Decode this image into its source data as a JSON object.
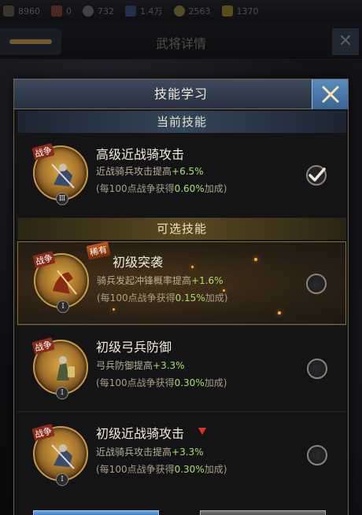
{
  "top_resources": [
    {
      "name": "power",
      "value": "8960"
    },
    {
      "name": "honor",
      "value": "0"
    },
    {
      "name": "food",
      "value": "732"
    },
    {
      "name": "coins",
      "value": "1.4万"
    },
    {
      "name": "gold",
      "value": "2563"
    },
    {
      "name": "ingots",
      "value": "1370"
    }
  ],
  "background_title": "武将详情",
  "modal": {
    "title": "技能学习",
    "current_section": "当前技能",
    "optional_section": "可选技能"
  },
  "current_skill": {
    "name": "高级近战骑攻击",
    "desc_prefix": "近战骑兵攻击提高",
    "desc_value": "+6.5%",
    "bonus_prefix": "(每100点战争获得",
    "bonus_value": "0.60%",
    "bonus_suffix": "加成)",
    "tag": "战争",
    "rank": "Ⅲ",
    "checked": true
  },
  "optional_skills": [
    {
      "name": "初级突袭",
      "desc_prefix": "骑兵发起冲锋概率提高",
      "desc_value": "+1.6%",
      "bonus_prefix": "(每100点战争获得",
      "bonus_value": "0.15%",
      "bonus_suffix": "加成)",
      "tag": "战争",
      "badge": "稀有",
      "rank": "Ⅰ",
      "selected": true
    },
    {
      "name": "初级弓兵防御",
      "desc_prefix": "弓兵防御提高",
      "desc_value": "+3.3%",
      "bonus_prefix": "(每100点战争获得",
      "bonus_value": "0.30%",
      "bonus_suffix": "加成)",
      "tag": "战争",
      "rank": "Ⅰ",
      "selected": false
    },
    {
      "name": "初级近战骑攻击",
      "desc_prefix": "近战骑兵攻击提高",
      "desc_value": "+3.3%",
      "bonus_prefix": "(每100点战争获得",
      "bonus_value": "0.30%",
      "bonus_suffix": "加成)",
      "tag": "战争",
      "rank": "Ⅰ",
      "downgrade": true,
      "selected": false
    }
  ],
  "colors": {
    "highlight_green": "#a8e06a",
    "gold_border": "#c89a48",
    "title_blue": "#3e4c5e"
  }
}
